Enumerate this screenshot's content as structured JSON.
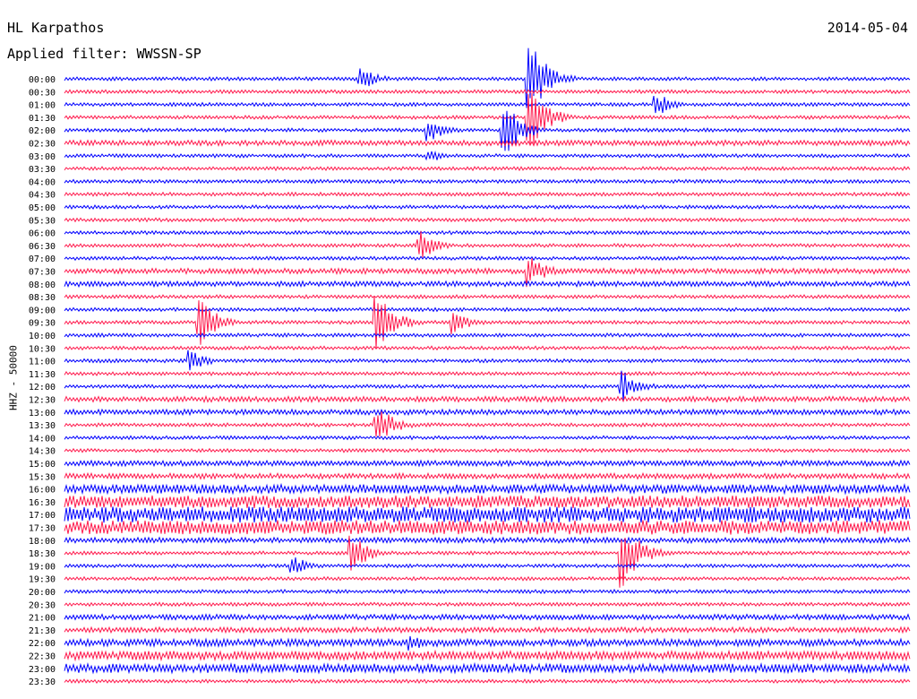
{
  "header": {
    "station": "HL Karpathos",
    "date": "2014-05-04",
    "filter": "Applied filter: WWSSN-SP",
    "channel_label": "HHZ - 50000"
  },
  "colors": {
    "odd_trace": "#0000ff",
    "even_trace": "#ff1a4d"
  },
  "chart_data": {
    "type": "line",
    "title": "HL Karpathos",
    "subtitle": "Applied filter: WWSSN-SP",
    "ylabel": "HHZ - 50000",
    "tick_labels": [
      "00:00",
      "00:30",
      "01:00",
      "01:30",
      "02:00",
      "02:30",
      "03:00",
      "03:30",
      "04:00",
      "04:30",
      "05:00",
      "05:30",
      "06:00",
      "06:30",
      "07:00",
      "07:30",
      "08:00",
      "08:30",
      "09:00",
      "09:30",
      "10:00",
      "10:30",
      "11:00",
      "11:30",
      "12:00",
      "12:30",
      "13:00",
      "13:30",
      "14:00",
      "14:30",
      "15:00",
      "15:30",
      "16:00",
      "16:30",
      "17:00",
      "17:30",
      "18:00",
      "18:30",
      "19:00",
      "19:30",
      "20:00",
      "20:30",
      "21:00",
      "21:30",
      "22:00",
      "22:30",
      "23:00",
      "23:30"
    ],
    "series_colors_alternate": [
      "blue",
      "red"
    ],
    "noise_level": [
      2,
      2,
      2,
      2,
      2,
      3,
      2,
      2,
      2,
      2,
      2,
      2,
      2,
      2,
      2,
      3,
      3,
      2,
      2,
      2,
      2,
      2,
      2,
      2,
      2,
      3,
      3,
      2,
      2,
      2,
      3,
      3,
      5,
      7,
      9,
      8,
      3,
      2,
      2,
      2,
      2,
      2,
      3,
      3,
      4,
      5,
      5,
      2
    ],
    "events": [
      {
        "row": 0,
        "x": 0.35,
        "amp": 14
      },
      {
        "row": 0,
        "x": 0.55,
        "amp": 46
      },
      {
        "row": 2,
        "x": 0.7,
        "amp": 14
      },
      {
        "row": 3,
        "x": 0.55,
        "amp": 40
      },
      {
        "row": 4,
        "x": 0.43,
        "amp": 14
      },
      {
        "row": 4,
        "x": 0.52,
        "amp": 36
      },
      {
        "row": 6,
        "x": 0.43,
        "amp": 10
      },
      {
        "row": 13,
        "x": 0.42,
        "amp": 18
      },
      {
        "row": 15,
        "x": 0.55,
        "amp": 18
      },
      {
        "row": 19,
        "x": 0.16,
        "amp": 28
      },
      {
        "row": 19,
        "x": 0.37,
        "amp": 36
      },
      {
        "row": 19,
        "x": 0.46,
        "amp": 14
      },
      {
        "row": 22,
        "x": 0.15,
        "amp": 12
      },
      {
        "row": 24,
        "x": 0.66,
        "amp": 18
      },
      {
        "row": 27,
        "x": 0.37,
        "amp": 24
      },
      {
        "row": 37,
        "x": 0.34,
        "amp": 22
      },
      {
        "row": 37,
        "x": 0.66,
        "amp": 40
      },
      {
        "row": 38,
        "x": 0.27,
        "amp": 12
      },
      {
        "row": 44,
        "x": 0.41,
        "amp": 10
      }
    ]
  }
}
